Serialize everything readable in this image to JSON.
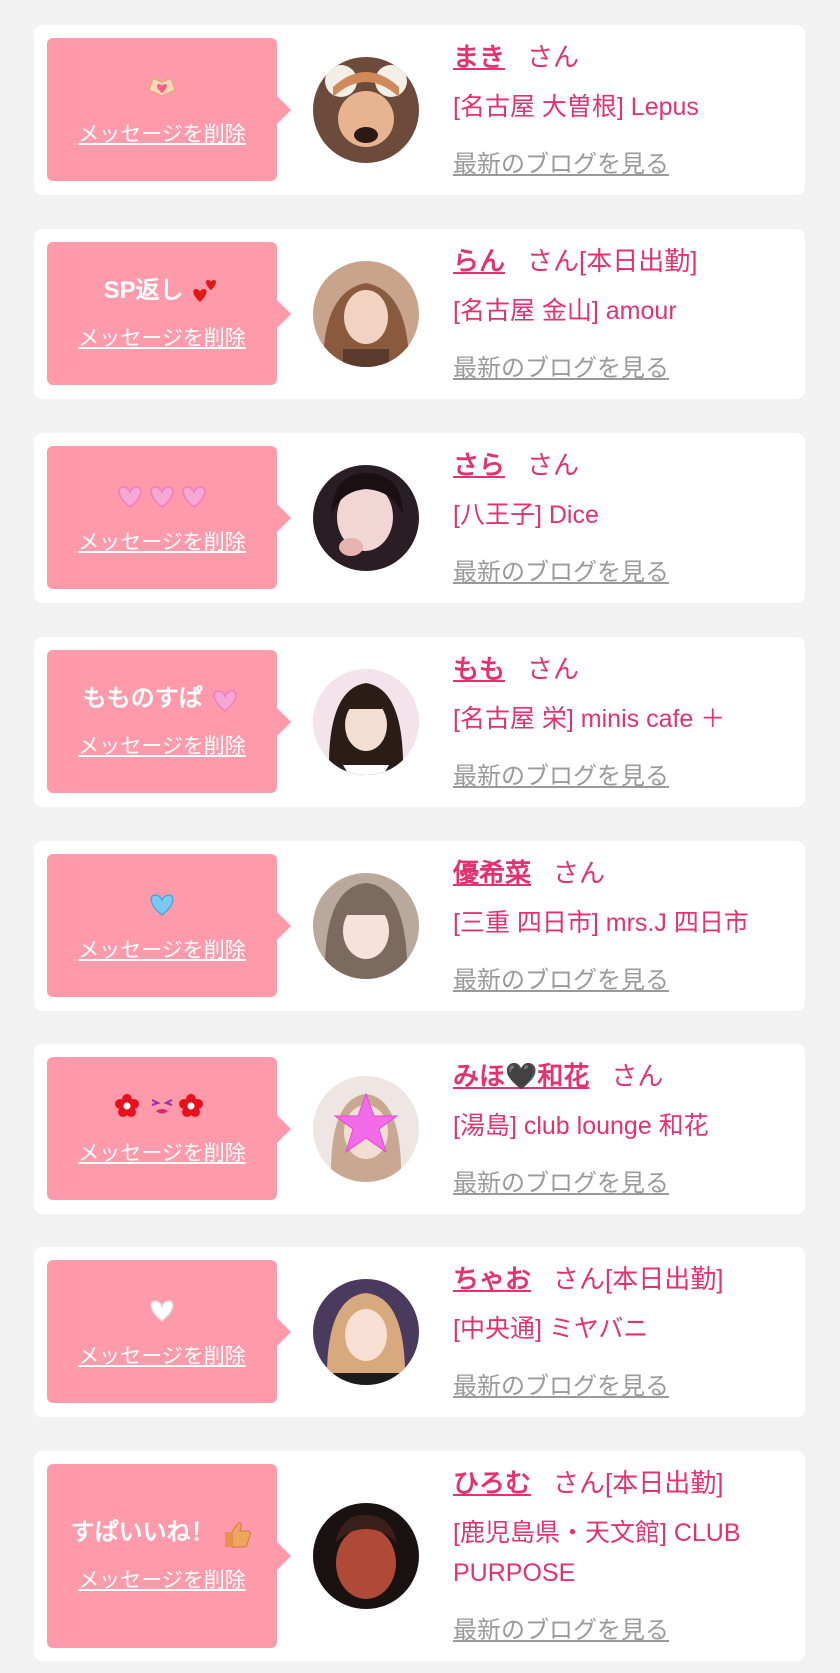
{
  "delete_label": "メッセージを削除",
  "blog_label": "最新のブログを見る",
  "san": "さん",
  "colors": {
    "accent": "#e4316f",
    "message_bg": "#ff9aab",
    "link_gray": "#9a9a9a"
  },
  "messages": [
    {
      "text": "",
      "emoji": "heart-hands-icon",
      "name": "まき",
      "status": "",
      "shop": "[名古屋 大曽根] Lepus"
    },
    {
      "text": "SP返し",
      "emoji": "two-hearts-icon",
      "name": "らん",
      "status": "[本日出勤]",
      "shop": "[名古屋 金山] amour"
    },
    {
      "text": "",
      "emoji": "three-pink-hearts-icon",
      "name": "さら",
      "status": "",
      "shop": "[八王子] Dice"
    },
    {
      "text": "もものすぱ",
      "emoji": "pink-heart-icon",
      "name": "もも",
      "status": "",
      "shop": "[名古屋 栄] minis cafe ＋"
    },
    {
      "text": "",
      "emoji": "blue-heart-icon",
      "name": "優希菜",
      "status": "",
      "shop": "[三重 四日市] mrs.J 四日市"
    },
    {
      "text": "",
      "emoji": "flower-kiss-icon",
      "name": "みほ🖤和花",
      "status": "",
      "shop": "[湯島] club lounge 和花"
    },
    {
      "text": "",
      "emoji": "white-heart-icon",
      "name": "ちゃお",
      "status": "[本日出勤]",
      "shop": "[中央通] ミヤバニ"
    },
    {
      "text": "すぱいいね！",
      "emoji": "thumbs-up-icon",
      "name": "ひろむ",
      "status": "[本日出勤]",
      "shop": "[鹿児島県・天文館] CLUB PURPOSE"
    }
  ]
}
